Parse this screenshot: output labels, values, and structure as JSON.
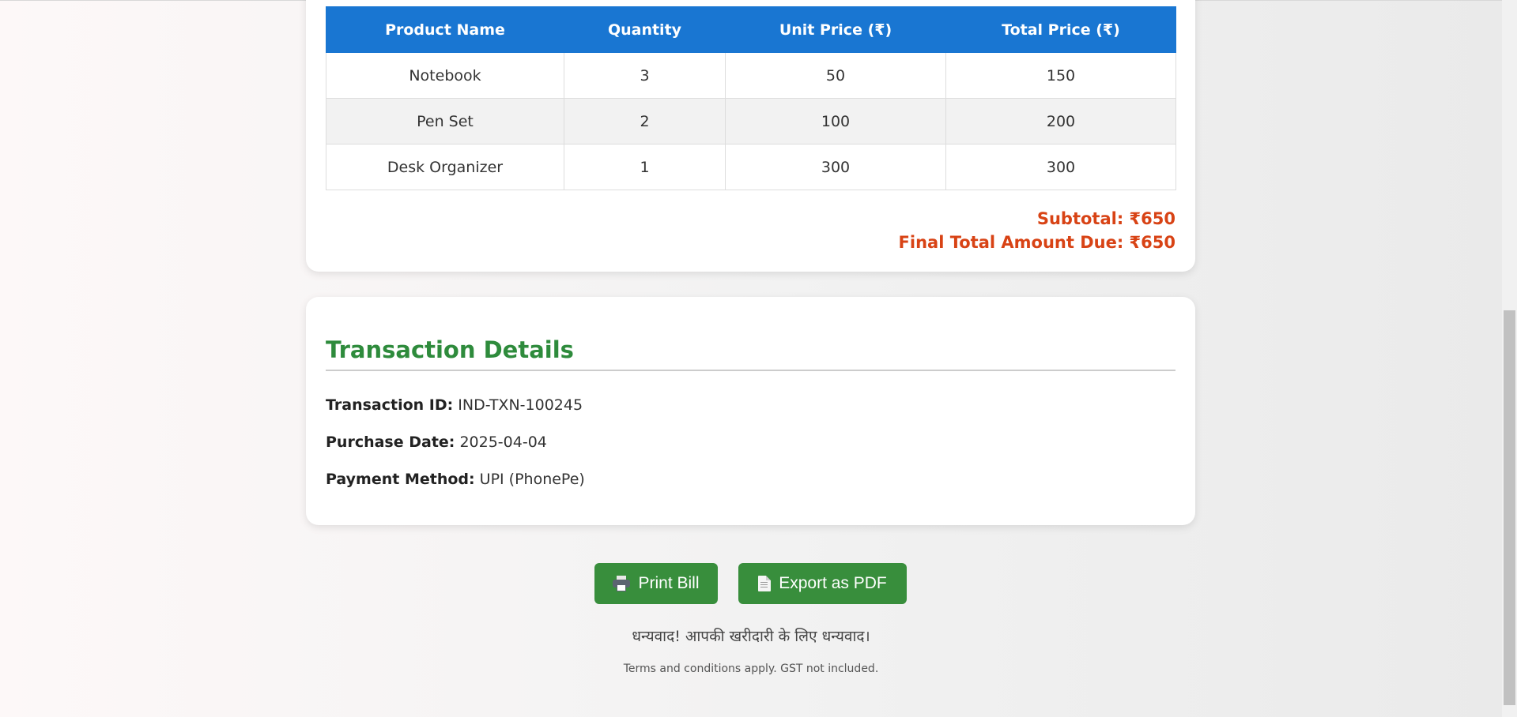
{
  "items_table": {
    "headers": [
      "Product Name",
      "Quantity",
      "Unit Price (₹)",
      "Total Price (₹)"
    ],
    "rows": [
      [
        "Notebook",
        "3",
        "50",
        "150"
      ],
      [
        "Pen Set",
        "2",
        "100",
        "200"
      ],
      [
        "Desk Organizer",
        "1",
        "300",
        "300"
      ]
    ]
  },
  "totals": {
    "subtotal": "Subtotal: ₹650",
    "final_total": "Final Total Amount Due: ₹650"
  },
  "transaction": {
    "title": "Transaction Details",
    "id_label": "Transaction ID:",
    "id_value": "IND-TXN-100245",
    "date_label": "Purchase Date:",
    "date_value": "2025-04-04",
    "method_label": "Payment Method:",
    "method_value": "UPI (PhonePe)"
  },
  "actions": {
    "print_label": "Print Bill",
    "export_label": "Export as PDF"
  },
  "footer": {
    "thanks": "धन्यवाद! आपकी खरीदारी के लिए धन्यवाद।",
    "terms": "Terms and conditions apply. GST not included."
  },
  "colors": {
    "table_header": "#1976d2",
    "total_text": "#d84315",
    "section_title": "#2e8b3c",
    "button_bg": "#388e3c"
  },
  "icons": {
    "print": "printer-icon",
    "export": "document-icon"
  }
}
